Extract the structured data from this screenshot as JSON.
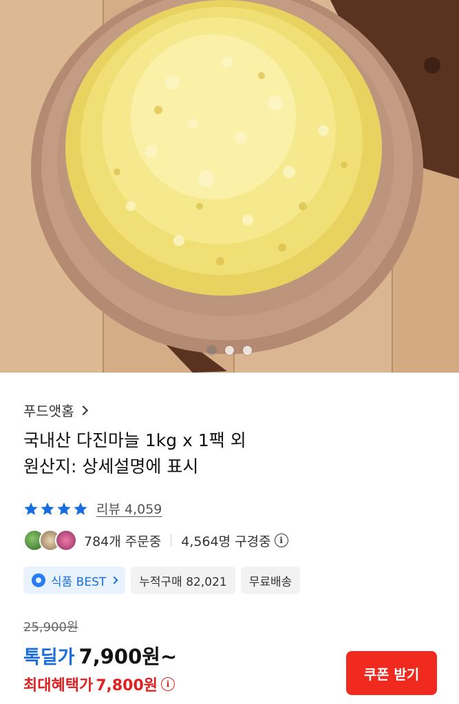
{
  "product": {
    "brand": "푸드앳홈",
    "title_line1": "국내산 다진마늘 1kg x 1팩 외",
    "title_line2": "원산지: 상세설명에 표시"
  },
  "image_carousel": {
    "count": 3,
    "current": 1
  },
  "rating": {
    "stars": 4,
    "review_label": "리뷰 4,059"
  },
  "stats": {
    "orders": "784개 주문중",
    "viewers": "4,564명 구경중",
    "info_icon": "i"
  },
  "badges": {
    "best": "식품 BEST",
    "cumulative": "누적구매 82,021",
    "shipping": "무료배송"
  },
  "pricing": {
    "original": "25,900원",
    "deal_label": "톡딜가",
    "deal_price": "7,900원~",
    "max_label": "최대혜택가",
    "max_price": "7,800원"
  },
  "actions": {
    "coupon": "쿠폰 받기"
  },
  "colors": {
    "accent_blue": "#1a6dde",
    "accent_red": "#f02a1f",
    "star": "#1a6dde"
  }
}
